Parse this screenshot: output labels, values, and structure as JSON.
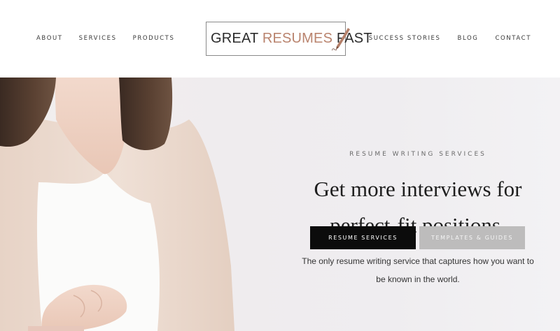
{
  "nav": {
    "left": [
      "ABOUT",
      "SERVICES",
      "PRODUCTS"
    ],
    "right": [
      "SUCCESS STORIES",
      "BLOG",
      "CONTACT"
    ]
  },
  "logo": {
    "part1": "GREAT ",
    "part2": "RESUMES",
    "part3": " FAST",
    "icon": "pen-icon"
  },
  "hero": {
    "eyebrow": "RESUME WRITING SERVICES",
    "headline_line1": "Get more interviews for",
    "headline_line2": "perfect-fit positions.",
    "subtext_line1": "The only resume writing service that captures how you want to",
    "subtext_line2": "be known in the world.",
    "primary_button": "RESUME SERVICES",
    "secondary_button": "TEMPLATES & GUIDES"
  },
  "colors": {
    "accent": "#b9836d",
    "primary_button_bg": "#0c0c0c",
    "secondary_button_bg": "#bdbcbc"
  }
}
